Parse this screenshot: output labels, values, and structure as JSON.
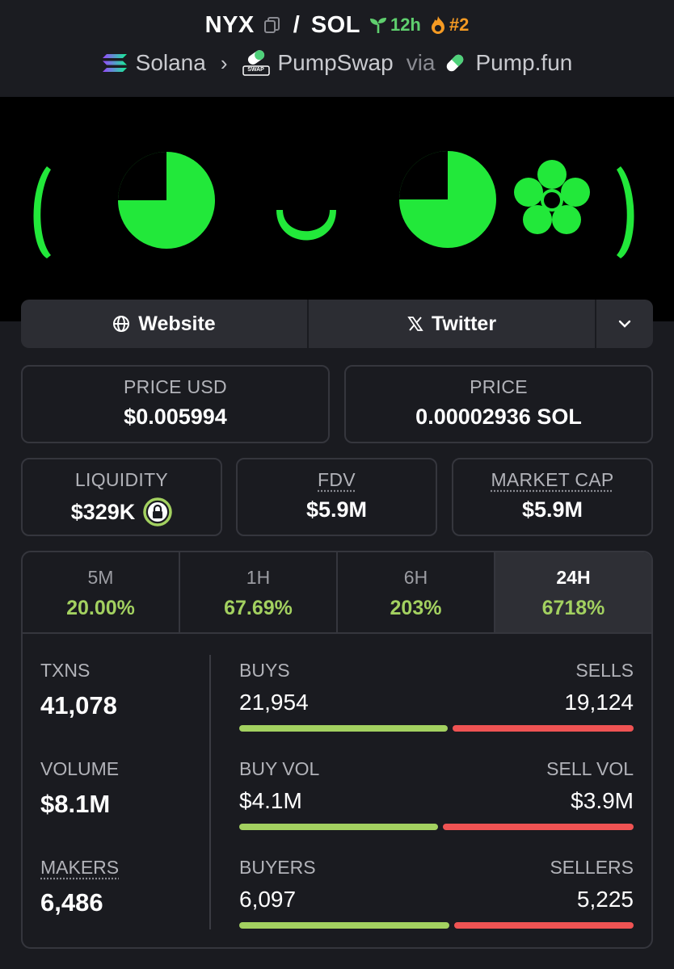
{
  "header": {
    "base_symbol": "NYX",
    "separator": "/",
    "quote_symbol": "SOL",
    "age": "12h",
    "rank": "#2",
    "chain": "Solana",
    "dex": "PumpSwap",
    "dex_badge": "SWAP",
    "via_label": "via",
    "launchpad": "Pump.fun"
  },
  "links": {
    "website": "Website",
    "twitter": "Twitter"
  },
  "cards": {
    "price_usd": {
      "label": "PRICE USD",
      "value": "$0.005994"
    },
    "price": {
      "label": "PRICE",
      "value": "0.00002936 SOL"
    },
    "liquidity": {
      "label": "LIQUIDITY",
      "value": "$329K"
    },
    "fdv": {
      "label": "FDV",
      "value": "$5.9M"
    },
    "market_cap": {
      "label": "MARKET CAP",
      "value": "$5.9M"
    }
  },
  "periods": [
    {
      "label": "5M",
      "change": "20.00%"
    },
    {
      "label": "1H",
      "change": "67.69%"
    },
    {
      "label": "6H",
      "change": "203%"
    },
    {
      "label": "24H",
      "change": "6718%"
    }
  ],
  "stats": {
    "txns": {
      "label": "TXNS",
      "value": "41,078"
    },
    "volume": {
      "label": "VOLUME",
      "value": "$8.1M"
    },
    "makers": {
      "label": "MAKERS",
      "value": "6,486"
    },
    "txn_split": {
      "left_label": "BUYS",
      "right_label": "SELLS",
      "left_value": "21,954",
      "right_value": "19,124",
      "buy_fraction": 0.534
    },
    "vol_split": {
      "left_label": "BUY VOL",
      "right_label": "SELL VOL",
      "left_value": "$4.1M",
      "right_value": "$3.9M",
      "buy_fraction": 0.51
    },
    "maker_split": {
      "left_label": "BUYERS",
      "right_label": "SELLERS",
      "left_value": "6,097",
      "right_value": "5,225",
      "buy_fraction": 0.538
    }
  },
  "colors": {
    "positive": "#a3d160",
    "negative": "#ef5353",
    "age": "#5fcf6e",
    "rank": "#f59a23",
    "banner_green": "#22e83a"
  }
}
